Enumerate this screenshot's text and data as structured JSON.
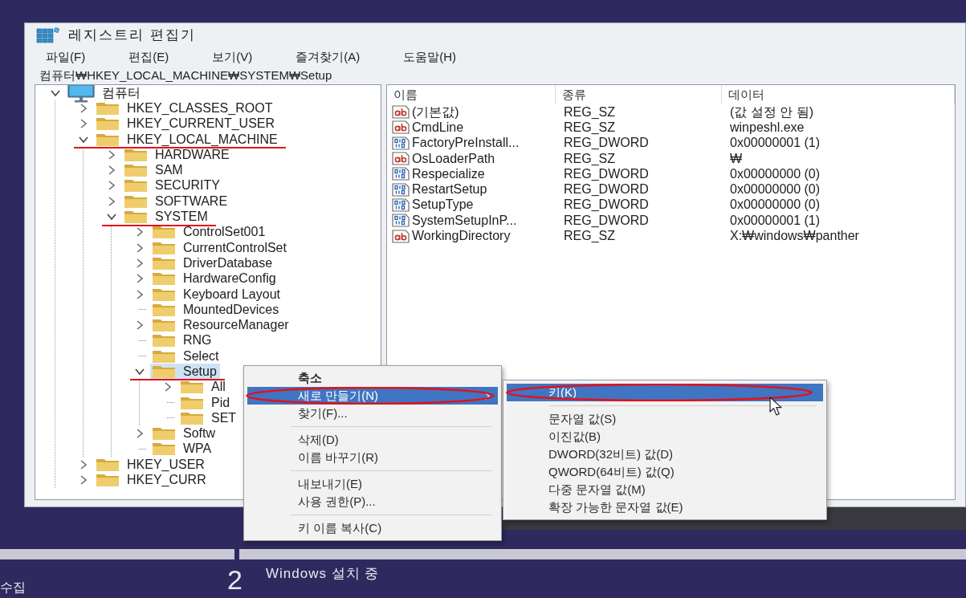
{
  "window": {
    "title": "레지스트리 편집기"
  },
  "menu_bar": [
    "파일(F)",
    "편집(E)",
    "보기(V)",
    "즐겨찾기(A)",
    "도움말(H)"
  ],
  "address_bar": {
    "value": "컴퓨터₩HKEY_LOCAL_MACHINE₩SYSTEM₩Setup"
  },
  "tree": [
    {
      "kind": "computer",
      "label": "컴퓨터",
      "expanded": true,
      "selected": false,
      "marked": false,
      "children": [
        {
          "kind": "folder",
          "label": "HKEY_CLASSES_ROOT",
          "expanded": false,
          "selected": false,
          "marked": false
        },
        {
          "kind": "folder",
          "label": "HKEY_CURRENT_USER",
          "expanded": false,
          "selected": false,
          "marked": false
        },
        {
          "kind": "folder",
          "label": "HKEY_LOCAL_MACHINE",
          "expanded": true,
          "selected": false,
          "marked": true,
          "children": [
            {
              "kind": "folder",
              "label": "HARDWARE",
              "expanded": false,
              "selected": false,
              "marked": false
            },
            {
              "kind": "folder",
              "label": "SAM",
              "expanded": false,
              "selected": false,
              "marked": false
            },
            {
              "kind": "folder",
              "label": "SECURITY",
              "expanded": false,
              "selected": false,
              "marked": false
            },
            {
              "kind": "folder",
              "label": "SOFTWARE",
              "expanded": false,
              "selected": false,
              "marked": false
            },
            {
              "kind": "folder",
              "label": "SYSTEM",
              "expanded": true,
              "selected": false,
              "marked": true,
              "children": [
                {
                  "kind": "folder",
                  "label": "ControlSet001",
                  "expanded": false,
                  "selected": false,
                  "marked": false
                },
                {
                  "kind": "folder",
                  "label": "CurrentControlSet",
                  "expanded": false,
                  "selected": false,
                  "marked": false
                },
                {
                  "kind": "folder",
                  "label": "DriverDatabase",
                  "expanded": false,
                  "selected": false,
                  "marked": false
                },
                {
                  "kind": "folder",
                  "label": "HardwareConfig",
                  "expanded": false,
                  "selected": false,
                  "marked": false
                },
                {
                  "kind": "folder",
                  "label": "Keyboard Layout",
                  "expanded": false,
                  "selected": false,
                  "marked": false
                },
                {
                  "kind": "leaf",
                  "label": "MountedDevices",
                  "expanded": false,
                  "selected": false,
                  "marked": false
                },
                {
                  "kind": "folder",
                  "label": "ResourceManager",
                  "expanded": false,
                  "selected": false,
                  "marked": false
                },
                {
                  "kind": "leaf",
                  "label": "RNG",
                  "expanded": false,
                  "selected": false,
                  "marked": false
                },
                {
                  "kind": "leaf",
                  "label": "Select",
                  "expanded": false,
                  "selected": false,
                  "marked": false
                },
                {
                  "kind": "folder",
                  "label": "Setup",
                  "expanded": true,
                  "selected": true,
                  "marked": true,
                  "children": [
                    {
                      "kind": "folder",
                      "label": "All",
                      "expanded": false,
                      "selected": false,
                      "marked": false
                    },
                    {
                      "kind": "leaf",
                      "label": "Pid",
                      "expanded": false,
                      "selected": false,
                      "marked": false
                    },
                    {
                      "kind": "leaf",
                      "label": "SET",
                      "expanded": false,
                      "selected": false,
                      "marked": false
                    }
                  ]
                },
                {
                  "kind": "folder",
                  "label": "Softw",
                  "expanded": false,
                  "selected": false,
                  "marked": false
                },
                {
                  "kind": "leaf",
                  "label": "WPA",
                  "expanded": false,
                  "selected": false,
                  "marked": false
                }
              ]
            }
          ]
        },
        {
          "kind": "folder",
          "label": "HKEY_USER",
          "expanded": false,
          "selected": false,
          "marked": false
        },
        {
          "kind": "folder",
          "label": "HKEY_CURR",
          "expanded": false,
          "selected": false,
          "marked": false
        }
      ]
    }
  ],
  "values": {
    "columns": [
      "이름",
      "종류",
      "데이터"
    ],
    "rows": [
      {
        "kind": "sz",
        "name": "(기본값)",
        "type": "REG_SZ",
        "data": "(값 설정 안 됨)"
      },
      {
        "kind": "sz",
        "name": "CmdLine",
        "type": "REG_SZ",
        "data": "winpeshl.exe"
      },
      {
        "kind": "dword",
        "name": "FactoryPreInstall...",
        "type": "REG_DWORD",
        "data": "0x00000001 (1)"
      },
      {
        "kind": "sz",
        "name": "OsLoaderPath",
        "type": "REG_SZ",
        "data": "₩"
      },
      {
        "kind": "dword",
        "name": "Respecialize",
        "type": "REG_DWORD",
        "data": "0x00000000 (0)"
      },
      {
        "kind": "dword",
        "name": "RestartSetup",
        "type": "REG_DWORD",
        "data": "0x00000000 (0)"
      },
      {
        "kind": "dword",
        "name": "SetupType",
        "type": "REG_DWORD",
        "data": "0x00000000 (0)"
      },
      {
        "kind": "dword",
        "name": "SystemSetupInP...",
        "type": "REG_DWORD",
        "data": "0x00000001 (1)"
      },
      {
        "kind": "sz",
        "name": "WorkingDirectory",
        "type": "REG_SZ",
        "data": "X:₩windows₩panther"
      }
    ]
  },
  "context_menu": {
    "items": [
      {
        "kind": "item",
        "label": "축소",
        "default": true,
        "selected": false,
        "circled": false,
        "submenu": false
      },
      {
        "kind": "item",
        "label": "새로 만들기(N)",
        "default": false,
        "selected": true,
        "circled": true,
        "submenu": true
      },
      {
        "kind": "item",
        "label": "찾기(F)...",
        "default": false,
        "selected": false,
        "circled": false,
        "submenu": false
      },
      {
        "kind": "separator"
      },
      {
        "kind": "item",
        "label": "삭제(D)",
        "default": false,
        "selected": false,
        "circled": false,
        "submenu": false
      },
      {
        "kind": "item",
        "label": "이름 바꾸기(R)",
        "default": false,
        "selected": false,
        "circled": false,
        "submenu": false
      },
      {
        "kind": "separator"
      },
      {
        "kind": "item",
        "label": "내보내기(E)",
        "default": false,
        "selected": false,
        "circled": false,
        "submenu": false
      },
      {
        "kind": "item",
        "label": "사용 권한(P)...",
        "default": false,
        "selected": false,
        "circled": false,
        "submenu": false
      },
      {
        "kind": "separator"
      },
      {
        "kind": "item",
        "label": "키 이름 복사(C)",
        "default": false,
        "selected": false,
        "circled": false,
        "submenu": false
      }
    ]
  },
  "submenu": {
    "items": [
      {
        "kind": "item",
        "label": "키(K)",
        "selected": true,
        "circled": true
      },
      {
        "kind": "separator"
      },
      {
        "kind": "item",
        "label": "문자열 값(S)",
        "selected": false,
        "circled": false
      },
      {
        "kind": "item",
        "label": "이진값(B)",
        "selected": false,
        "circled": false
      },
      {
        "kind": "item",
        "label": "DWORD(32비트) 값(D)",
        "selected": false,
        "circled": false
      },
      {
        "kind": "item",
        "label": "QWORD(64비트) 값(Q)",
        "selected": false,
        "circled": false
      },
      {
        "kind": "item",
        "label": "다중 문자열 값(M)",
        "selected": false,
        "circled": false
      },
      {
        "kind": "item",
        "label": "확장 가능한 문자열 값(E)",
        "selected": false,
        "circled": false
      }
    ]
  },
  "installer": {
    "side_label": "수집",
    "step_number": "2",
    "step_label": "Windows 설치 중"
  }
}
